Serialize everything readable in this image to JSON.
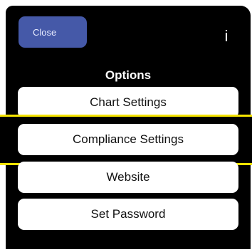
{
  "header": {
    "close_label": "Close",
    "info_label": "i",
    "close_color": "#4559a8"
  },
  "panel": {
    "title": "Options",
    "options": [
      {
        "label": "Chart Settings"
      },
      {
        "label": "Compliance Settings",
        "highlighted": true
      },
      {
        "label": "Website"
      },
      {
        "label": "Set Password"
      }
    ]
  },
  "colors": {
    "background": "#000000",
    "button_bg": "#ffffff",
    "highlight": "#f5e400"
  }
}
